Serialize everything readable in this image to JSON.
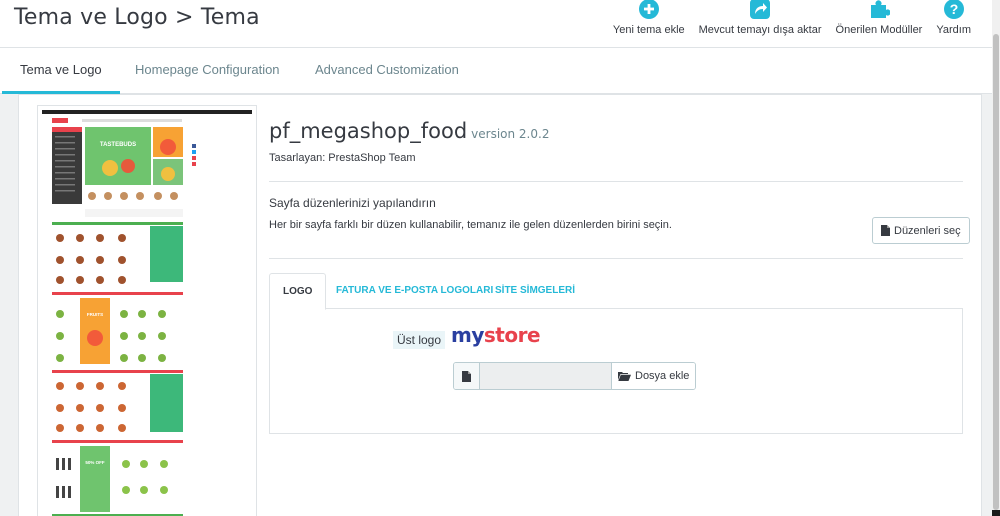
{
  "header": {
    "title": "Tema ve Logo > Tema",
    "toolbar": [
      {
        "label": "Yeni tema ekle",
        "icon": "plus-circle-icon"
      },
      {
        "label": "Mevcut temayı dışa aktar",
        "icon": "share-icon"
      },
      {
        "label": "Önerilen Modüller",
        "icon": "puzzle-icon"
      },
      {
        "label": "Yardım",
        "icon": "help-icon"
      }
    ]
  },
  "tabs": [
    {
      "label": "Tema ve Logo",
      "active": true
    },
    {
      "label": "Homepage Configuration",
      "active": false
    },
    {
      "label": "Advanced Customization",
      "active": false
    }
  ],
  "theme": {
    "name": "pf_megashop_food",
    "version": "version 2.0.2",
    "author": "Tasarlayan: PrestaShop Team"
  },
  "layout": {
    "title": "Sayfa düzenlerinizi yapılandırın",
    "description": "Her bir sayfa farklı bir düzen kullanabilir, temanız ile gelen düzenlerden birini seçin.",
    "button": "Düzenleri seç"
  },
  "logo_tabs": [
    {
      "label": "LOGO",
      "active": true
    },
    {
      "label": "FATURA VE E-POSTA LOGOLARI",
      "active": false
    },
    {
      "label": "SİTE SİMGELERİ",
      "active": false
    }
  ],
  "logo": {
    "label": "Üst logo",
    "store_word1": "my",
    "store_word2": "store",
    "upload_button": "Dosya ekle"
  },
  "preview": {
    "banner1": "TASTEBUDS",
    "banner2": "FRUITS",
    "banner3": "50% OFF"
  },
  "colors": {
    "accent": "#25b9d7",
    "text": "#363a41",
    "muted": "#6c868e",
    "logo_my": "#2a3fa0",
    "logo_store": "#e8424c"
  }
}
